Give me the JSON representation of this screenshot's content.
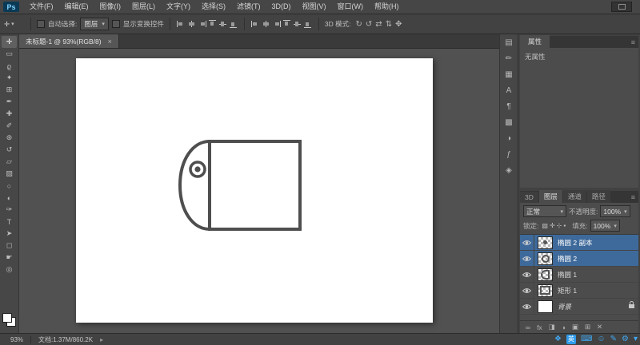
{
  "glyphs": {
    "caret": "▾"
  },
  "menu": {
    "logo": "Ps",
    "items": [
      "文件(F)",
      "编辑(E)",
      "图像(I)",
      "图层(L)",
      "文字(Y)",
      "选择(S)",
      "滤镜(T)",
      "3D(D)",
      "视图(V)",
      "窗口(W)",
      "帮助(H)"
    ]
  },
  "options": {
    "tool_icon": "✛",
    "auto_select_label": "自动选择:",
    "auto_select_value": "图层",
    "show_transform_label": "显示变换控件",
    "mode_3d_label": "3D 模式:",
    "align_kinds": [
      "left",
      "hcenter",
      "right",
      "top",
      "vcenter",
      "bottom"
    ],
    "mode_3d_icons": [
      {
        "name": "3d-rotate-icon",
        "glyph": "↻"
      },
      {
        "name": "3d-roll-icon",
        "glyph": "↺"
      },
      {
        "name": "3d-drag-icon",
        "glyph": "⇄"
      },
      {
        "name": "3d-slide-icon",
        "glyph": "⇅"
      },
      {
        "name": "3d-scale-icon",
        "glyph": "✥"
      }
    ]
  },
  "doc": {
    "tab_title": "未标题-1 @ 93%(RGB/8)",
    "close_glyph": "×"
  },
  "canvas": {
    "stroke": "#4e4e4e",
    "shape_description": "tag shape: rectangle with half-round left end and eyelet circle"
  },
  "tools": [
    {
      "name": "move-tool",
      "glyph": "✛",
      "active": true
    },
    {
      "name": "marquee-tool",
      "glyph": "▭"
    },
    {
      "name": "lasso-tool",
      "glyph": "ϱ"
    },
    {
      "name": "quick-selection-tool",
      "glyph": "✦"
    },
    {
      "name": "crop-tool",
      "glyph": "⊞"
    },
    {
      "name": "eyedropper-tool",
      "glyph": "✒"
    },
    {
      "name": "healing-brush-tool",
      "glyph": "✚"
    },
    {
      "name": "brush-tool",
      "glyph": "✐"
    },
    {
      "name": "clone-stamp-tool",
      "glyph": "⊛"
    },
    {
      "name": "history-brush-tool",
      "glyph": "↺"
    },
    {
      "name": "eraser-tool",
      "glyph": "▱"
    },
    {
      "name": "gradient-tool",
      "glyph": "▨"
    },
    {
      "name": "blur-tool",
      "glyph": "○"
    },
    {
      "name": "dodge-tool",
      "glyph": "◐"
    },
    {
      "name": "pen-tool",
      "glyph": "✑"
    },
    {
      "name": "type-tool",
      "glyph": "T"
    },
    {
      "name": "path-selection-tool",
      "glyph": "➤"
    },
    {
      "name": "shape-tool",
      "glyph": "◻"
    },
    {
      "name": "hand-tool",
      "glyph": "☛"
    },
    {
      "name": "zoom-tool",
      "glyph": "◎"
    }
  ],
  "right_strip": [
    {
      "name": "history-panel-icon",
      "glyph": "▤"
    },
    {
      "name": "brush-panel-icon",
      "glyph": "✏"
    },
    {
      "name": "clone-source-panel-icon",
      "glyph": "▦"
    },
    {
      "name": "character-panel-icon",
      "glyph": "A"
    },
    {
      "name": "paragraph-panel-icon",
      "glyph": "¶"
    },
    {
      "name": "swatches-panel-icon",
      "glyph": "▩"
    },
    {
      "name": "adjustments-panel-icon",
      "glyph": "◑"
    },
    {
      "name": "styles-panel-icon",
      "glyph": "ƒ"
    },
    {
      "name": "info-panel-icon",
      "glyph": "◈"
    }
  ],
  "panels": {
    "properties": {
      "tab": "属性",
      "empty": "无属性",
      "menu_glyph": "≡"
    },
    "layers": {
      "tabs": [
        "3D",
        "图层",
        "通道",
        "路径"
      ],
      "active_tab": "图层",
      "blend_mode": "正常",
      "opacity_label": "不透明度:",
      "opacity_value": "100%",
      "lock_label": "锁定:",
      "lock_icons": [
        {
          "name": "lock-transparency-icon",
          "glyph": "▨"
        },
        {
          "name": "lock-pixels-icon",
          "glyph": "✛"
        },
        {
          "name": "lock-position-icon",
          "glyph": "⊹"
        },
        {
          "name": "lock-all-icon",
          "glyph": "▪"
        }
      ],
      "fill_label": "填充:",
      "fill_value": "100%",
      "rows": [
        {
          "name": "椭圆 2 副本",
          "selected": true,
          "thumb": "dot",
          "visible": true
        },
        {
          "name": "椭圆 2",
          "selected": true,
          "thumb": "ring",
          "visible": true
        },
        {
          "name": "椭圆 1",
          "selected": false,
          "thumb": "dshape",
          "visible": true
        },
        {
          "name": "矩形 1",
          "selected": false,
          "thumb": "rect",
          "visible": true
        },
        {
          "name": "背景",
          "selected": false,
          "thumb": "white",
          "visible": true,
          "locked": true,
          "italic": true
        }
      ],
      "bottom_icons": [
        {
          "name": "link-layers-icon",
          "glyph": "∞"
        },
        {
          "name": "layer-style-icon",
          "glyph": "fx"
        },
        {
          "name": "layer-mask-icon",
          "glyph": "◨"
        },
        {
          "name": "adjustment-layer-icon",
          "glyph": "◑"
        },
        {
          "name": "layer-group-icon",
          "glyph": "▣"
        },
        {
          "name": "new-layer-icon",
          "glyph": "⊞"
        },
        {
          "name": "delete-layer-icon",
          "glyph": "✕"
        }
      ]
    }
  },
  "status": {
    "zoom": "93%",
    "doc_info": "文档:1.37M/860.2K",
    "arrow": "▸"
  },
  "ime": {
    "icons": [
      {
        "name": "ime-logo-icon",
        "glyph": "❖"
      },
      {
        "name": "ime-lang-toggle",
        "glyph": "英",
        "boxed": true
      },
      {
        "name": "ime-keyboard-icon",
        "glyph": "⌨"
      },
      {
        "name": "ime-emoji-icon",
        "glyph": "☺"
      },
      {
        "name": "ime-pen-icon",
        "glyph": "✎"
      },
      {
        "name": "ime-settings-icon",
        "glyph": "⚙"
      },
      {
        "name": "ime-more-icon",
        "glyph": "▾"
      }
    ]
  }
}
